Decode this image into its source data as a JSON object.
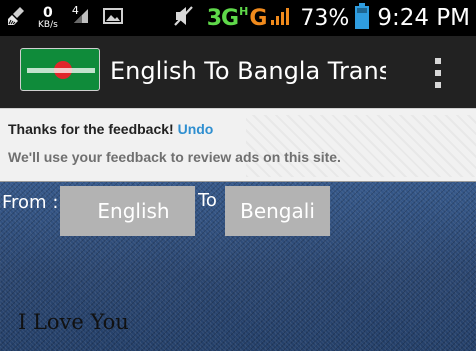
{
  "status_bar": {
    "speed_value": "0",
    "speed_unit": "KB/s",
    "sim_number": "4",
    "network_type": "3G",
    "network_sub": "H",
    "network_g": "G",
    "battery_percent": "73%",
    "time": "9:24 PM",
    "icons": [
      "broom-cleaner-icon",
      "sim-signal-icon",
      "image-notification-icon",
      "mute-icon",
      "signal-bars-icon",
      "battery-icon"
    ],
    "colors": {
      "network_green": "#5fd84a",
      "network_orange": "#f08a1c",
      "battery_blue": "#2f9de0"
    }
  },
  "action_bar": {
    "title": "English To Bangla Translator",
    "logo_icon": "bangladesh-flag-icon",
    "menu_icon": "overflow-menu-icon",
    "background": "#222222"
  },
  "ad_feedback": {
    "thanks_text": "Thanks for the feedback!",
    "undo_label": "Undo",
    "message": "We'll use your feedback to review ads on this site."
  },
  "translator": {
    "from_label": "From :",
    "source_language": "English",
    "to_label": "To",
    "target_language": "Bengali",
    "input_text": "I Love You"
  }
}
